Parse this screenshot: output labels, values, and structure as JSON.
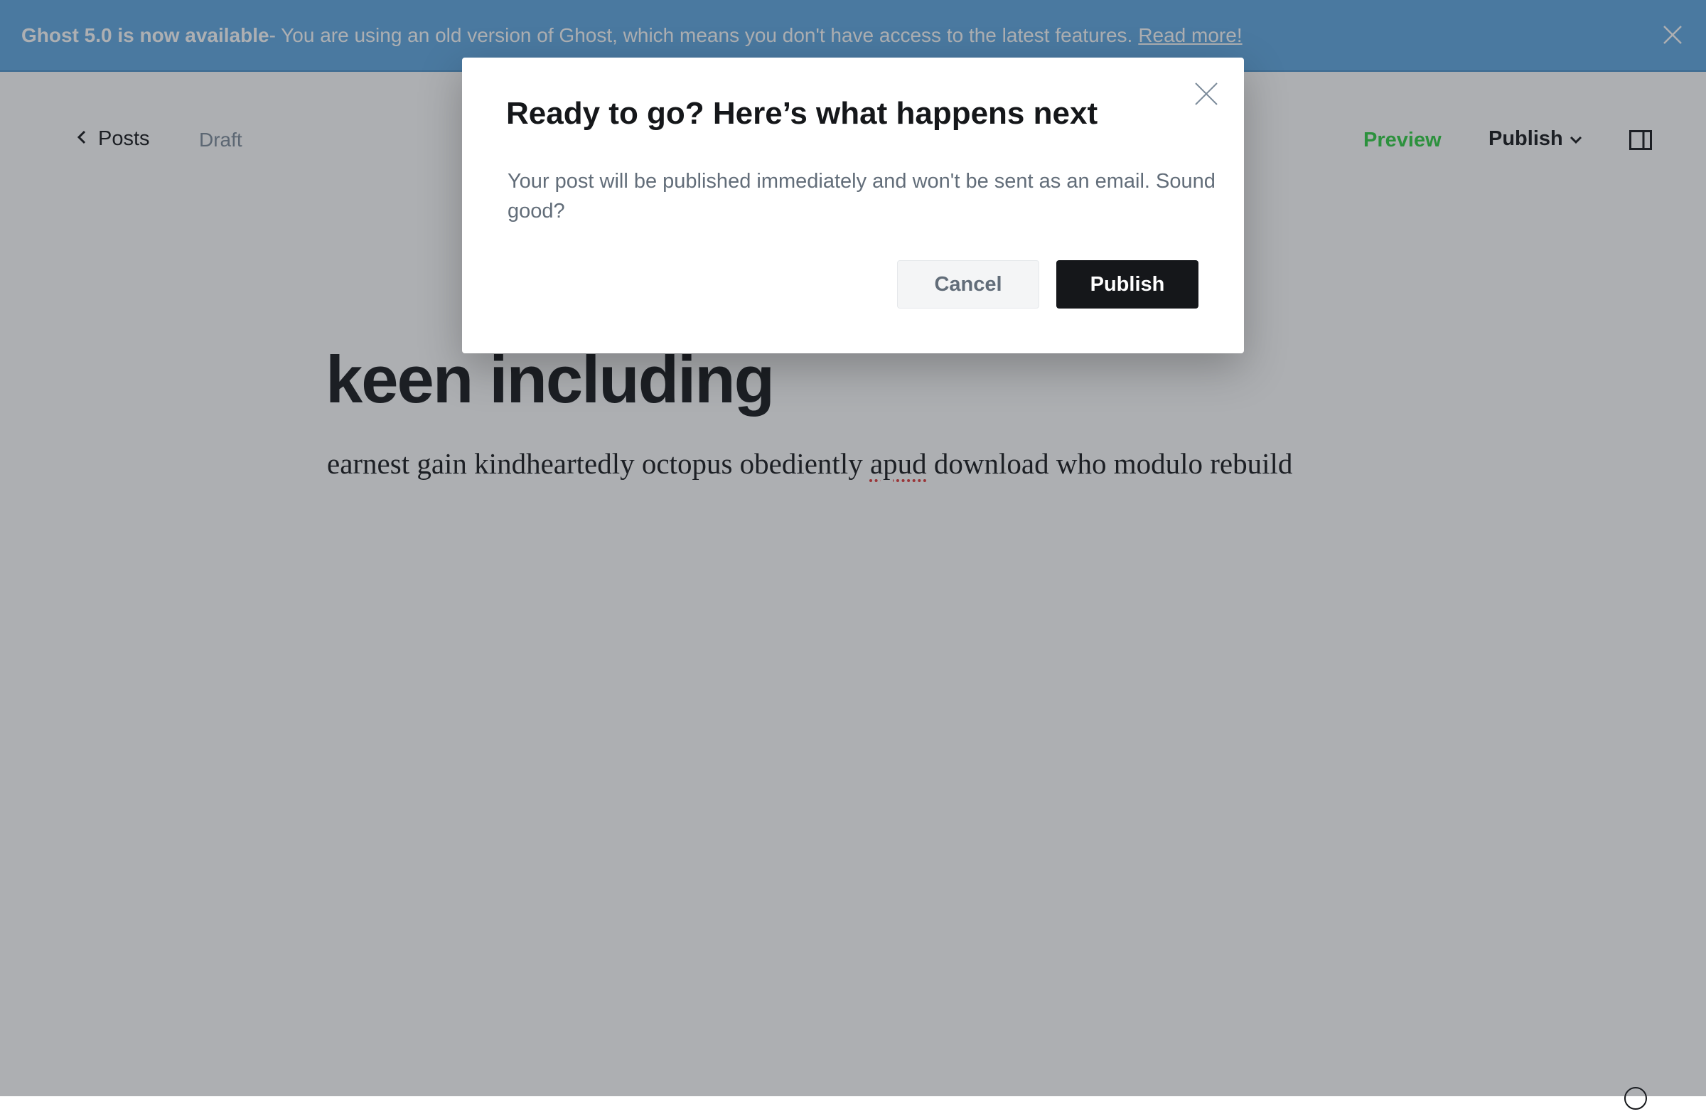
{
  "banner": {
    "strong": "Ghost 5.0 is now available",
    "text": " - You are using an old version of Ghost, which means you don't have access to the latest features.",
    "link": "Read more!"
  },
  "header": {
    "back_label": "Posts",
    "status": "Draft",
    "preview": "Preview",
    "publish": "Publish"
  },
  "post": {
    "title": "keen including",
    "body_before": "earnest gain kindheartedly octopus obediently ",
    "body_misspelled": "apud",
    "body_after": " download who modulo rebuild"
  },
  "modal": {
    "title": "Ready to go? Here’s what happens next",
    "text": "Your post will be published immediately and won't be sent as an email. Sound good?",
    "cancel": "Cancel",
    "publish": "Publish"
  },
  "icons": {
    "banner_close": "close-icon",
    "back": "chevron-left-icon",
    "publish_dropdown": "chevron-down-icon",
    "sidebar": "sidebar-toggle-icon",
    "modal_close": "close-icon"
  },
  "colors": {
    "banner": "#5fa9e3",
    "preview": "#30cf43",
    "primary_button": "#15171a"
  }
}
